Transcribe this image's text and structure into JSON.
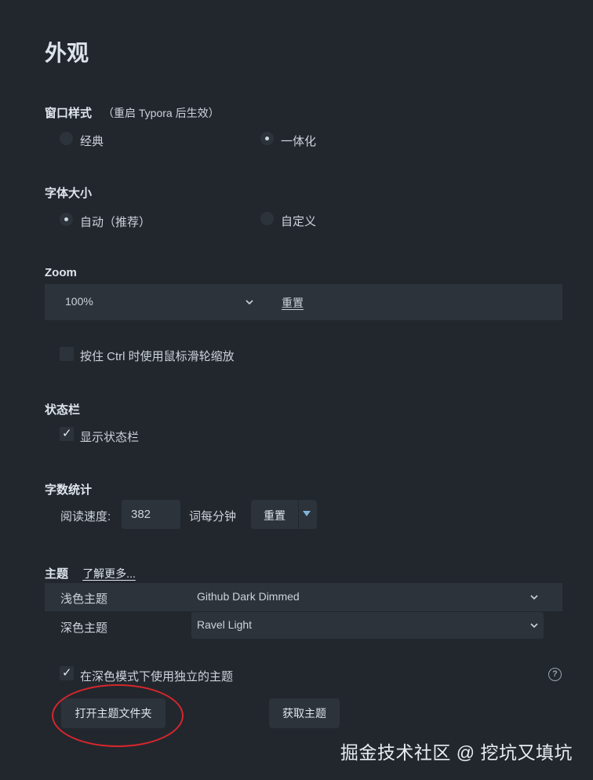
{
  "page": {
    "title": "外观"
  },
  "window_style": {
    "label": "窗口样式",
    "note": "（重启 Typora 后生效）",
    "options": [
      {
        "label": "经典",
        "selected": false
      },
      {
        "label": "一体化",
        "selected": true
      }
    ]
  },
  "font_size": {
    "label": "字体大小",
    "options": [
      {
        "label": "自动（推荐）",
        "selected": true
      },
      {
        "label": "自定义",
        "selected": false
      }
    ]
  },
  "zoom": {
    "label": "Zoom",
    "value": "100%",
    "reset_label": "重置",
    "ctrl_scroll": {
      "label": "按住 Ctrl 时使用鼠标滑轮缩放",
      "checked": false
    }
  },
  "status_bar": {
    "label": "状态栏",
    "show": {
      "label": "显示状态栏",
      "checked": true
    }
  },
  "word_count": {
    "label": "字数统计",
    "speed_label": "阅读速度:",
    "speed_value": "382",
    "unit_label": "词每分钟",
    "reset_label": "重置"
  },
  "theme": {
    "label": "主题",
    "learn_more": "了解更多...",
    "light_label": "浅色主题",
    "light_value": "Github Dark Dimmed",
    "dark_label": "深色主题",
    "dark_value": "Ravel Light",
    "separate": {
      "label": "在深色模式下使用独立的主题",
      "checked": true
    },
    "open_folder_label": "打开主题文件夹",
    "get_themes_label": "获取主题"
  },
  "watermark": "掘金技术社区 @ 挖坑又填坑",
  "colors": {
    "background": "#22272e",
    "control": "#2d333b",
    "text": "#cdd3da",
    "accent": "#7fb3d8",
    "annotation": "#d9262b"
  }
}
